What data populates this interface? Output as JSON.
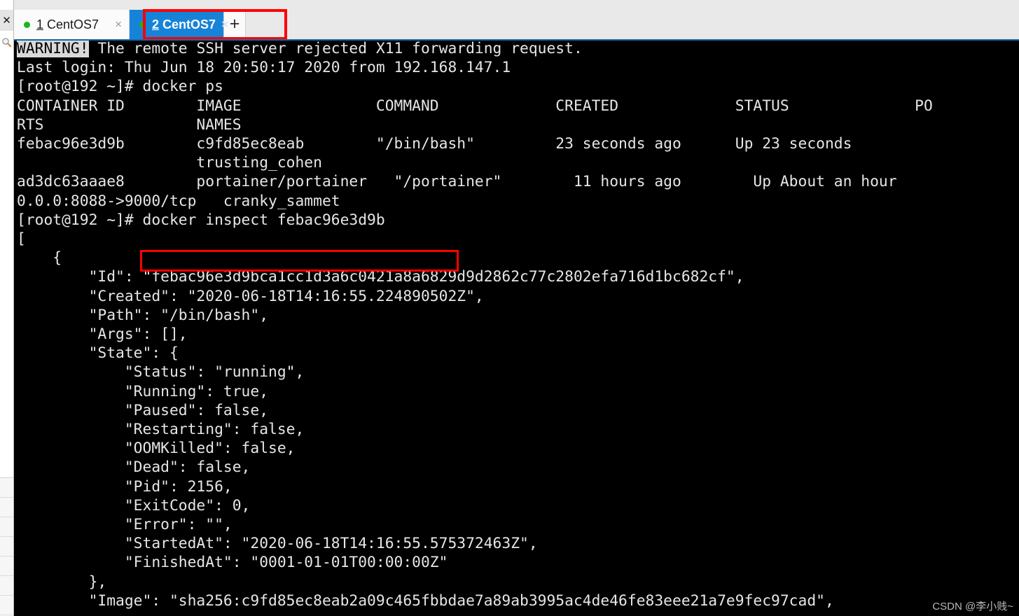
{
  "window": {
    "accent_blue": "#1683d8",
    "annotation_red": "#ff0000",
    "terminal_bg": "#000000",
    "terminal_fg": "#e6e6e6"
  },
  "left_rail": {
    "close_icon_label": "✕",
    "search_icon_name": "magnifier-icon",
    "row_count": 7
  },
  "tabs": {
    "new_tab_label": "+",
    "items": [
      {
        "index": "1",
        "title": "CentOS7",
        "active": false,
        "status_dot_color": "#18b818",
        "close_label": "×"
      },
      {
        "index": "2",
        "title": "CentOS7",
        "active": true,
        "status_dot_color": "#18b818",
        "close_label": "×"
      }
    ]
  },
  "annotations": {
    "tab_box_target": "2 CentOS7 tab and new-tab button",
    "command_box_target": "docker inspect febac96e3d9b"
  },
  "terminal": {
    "warning_tag": "WARNING!",
    "warning_rest": " The remote SSH server rejected X11 forwarding request.",
    "lines": [
      "Last login: Thu Jun 18 20:50:17 2020 from 192.168.147.1",
      "[root@192 ~]# docker ps",
      "CONTAINER ID        IMAGE               COMMAND             CREATED             STATUS              PO",
      "RTS                 NAMES",
      "febac96e3d9b        c9fd85ec8eab        \"/bin/bash\"         23 seconds ago      Up 23 seconds",
      "                    trusting_cohen",
      "ad3dc63aaae8        portainer/portainer   \"/portainer\"        11 hours ago        Up About an hour",
      "0.0.0:8088->9000/tcp   cranky_sammet",
      "[root@192 ~]# docker inspect febac96e3d9b",
      "[",
      "    {",
      "        \"Id\": \"febac96e3d9bca1cc1d3a6c0421a8a6829d9d2862c77c2802efa716d1bc682cf\",",
      "        \"Created\": \"2020-06-18T14:16:55.224890502Z\",",
      "        \"Path\": \"/bin/bash\",",
      "        \"Args\": [],",
      "        \"State\": {",
      "            \"Status\": \"running\",",
      "            \"Running\": true,",
      "            \"Paused\": false,",
      "            \"Restarting\": false,",
      "            \"OOMKilled\": false,",
      "            \"Dead\": false,",
      "            \"Pid\": 2156,",
      "            \"ExitCode\": 0,",
      "            \"Error\": \"\",",
      "            \"StartedAt\": \"2020-06-18T14:16:55.575372463Z\",",
      "            \"FinishedAt\": \"0001-01-01T00:00:00Z\"",
      "        },",
      "        \"Image\": \"sha256:c9fd85ec8eab2a09c465fbbdae7a89ab3995ac4de46fe83eee21a7e9fec97cad\","
    ],
    "docker_ps": {
      "headers": [
        "CONTAINER ID",
        "IMAGE",
        "COMMAND",
        "CREATED",
        "STATUS",
        "PORTS",
        "NAMES"
      ],
      "rows": [
        {
          "container_id": "febac96e3d9b",
          "image": "c9fd85ec8eab",
          "command": "\"/bin/bash\"",
          "created": "23 seconds ago",
          "status": "Up 23 seconds",
          "ports": "",
          "names": "trusting_cohen"
        },
        {
          "container_id": "ad3dc63aaae8",
          "image": "portainer/portainer",
          "command": "\"/portainer\"",
          "created": "11 hours ago",
          "status": "Up About an hour",
          "ports": "0.0.0:8088->9000/tcp",
          "names": "cranky_sammet"
        }
      ]
    },
    "inspect": {
      "Id": "febac96e3d9bca1cc1d3a6c0421a8a6829d9d2862c77c2802efa716d1bc682cf",
      "Created": "2020-06-18T14:16:55.224890502Z",
      "Path": "/bin/bash",
      "Args": "[]",
      "State": {
        "Status": "running",
        "Running": "true",
        "Paused": "false",
        "Restarting": "false",
        "OOMKilled": "false",
        "Dead": "false",
        "Pid": "2156",
        "ExitCode": "0",
        "Error": "\"\"",
        "StartedAt": "2020-06-18T14:16:55.575372463Z",
        "FinishedAt": "0001-01-01T00:00:00Z"
      },
      "Image": "sha256:c9fd85ec8eab2a09c465fbbdae7a89ab3995ac4de46fe83eee21a7e9fec97cad"
    }
  },
  "watermark": "CSDN @李小贱~"
}
